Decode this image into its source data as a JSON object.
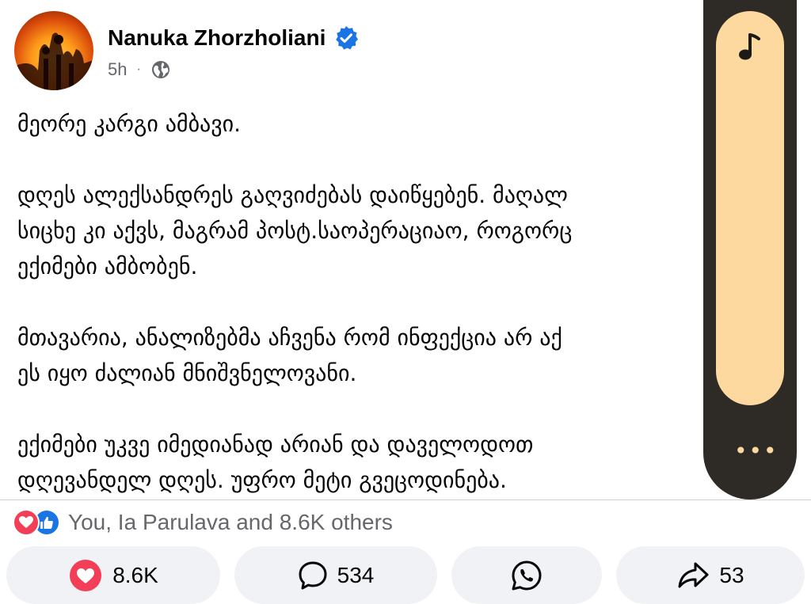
{
  "post": {
    "author": "Nanuka Zhorzholiani",
    "time": "5h",
    "separator": "·",
    "paragraphs": [
      [
        "მეორე კარგი ამბავი."
      ],
      [
        "დღეს ალექსანდრეს გაღვიძებას დაიწყებენ. მაღალ",
        "სიცხე კი აქვს, მაგრამ პოსტ.საოპერაციაო, როგორც",
        "ექიმები ამბობენ."
      ],
      [
        "მთავარია, ანალიზებმა აჩვენა რომ ინფექცია არ აქ",
        "ეს იყო ძალიან მნიშვნელოვანი."
      ],
      [
        "ექიმები უკვე იმედიანად არიან და დაველოდოთ",
        "დღევანდელ დღეს. უფრო მეტი გვეცოდინება."
      ]
    ]
  },
  "reactions": {
    "summary": "You, Ia Parulava and 8.6K others",
    "icons": [
      "love-icon",
      "like-icon"
    ]
  },
  "actions": {
    "like_count": "8.6K",
    "comment_count": "534",
    "share_count": "53"
  },
  "overlay": {
    "icons": [
      "music-note-icon",
      "more-icon"
    ],
    "more_label": "•••"
  },
  "colors": {
    "accent_blue": "#1b74e4",
    "love_red": "#f33e58",
    "overlay_bg": "#2e2a25",
    "overlay_pill": "#fdd9a0",
    "action_bg": "#f0f2f5",
    "muted_text": "#65676b"
  }
}
